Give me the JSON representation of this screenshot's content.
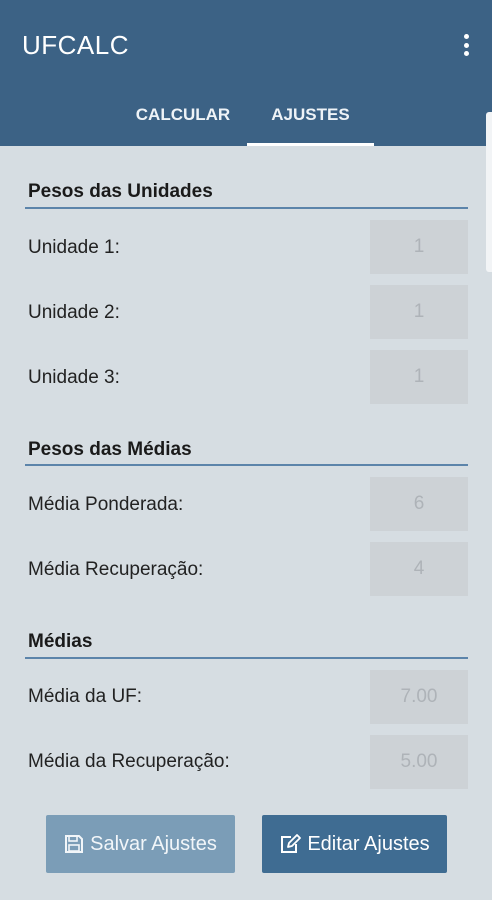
{
  "app": {
    "title": "UFCALC"
  },
  "tabs": [
    {
      "label": "CALCULAR"
    },
    {
      "label": "AJUSTES"
    }
  ],
  "sections": {
    "unidades": {
      "title": "Pesos das Unidades",
      "rows": [
        {
          "label": "Unidade 1:",
          "value": "1"
        },
        {
          "label": "Unidade 2:",
          "value": "1"
        },
        {
          "label": "Unidade 3:",
          "value": "1"
        }
      ]
    },
    "medias_pesos": {
      "title": "Pesos das Médias",
      "rows": [
        {
          "label": "Média Ponderada:",
          "value": "6"
        },
        {
          "label": "Média Recuperação:",
          "value": "4"
        }
      ]
    },
    "medias": {
      "title": "Médias",
      "rows": [
        {
          "label": "Média da UF:",
          "value": "7.00"
        },
        {
          "label": "Média da Recuperação:",
          "value": "5.00"
        }
      ]
    }
  },
  "buttons": {
    "save": {
      "label": "Salvar Ajustes",
      "icon": "save-icon"
    },
    "edit": {
      "label": "Editar Ajustes",
      "icon": "edit-icon"
    }
  },
  "colors": {
    "primary": "#3c6285",
    "background": "#d6dde2",
    "divider": "#5c84aa",
    "save_button": "#7b9db7",
    "edit_button": "#3f6c92"
  }
}
